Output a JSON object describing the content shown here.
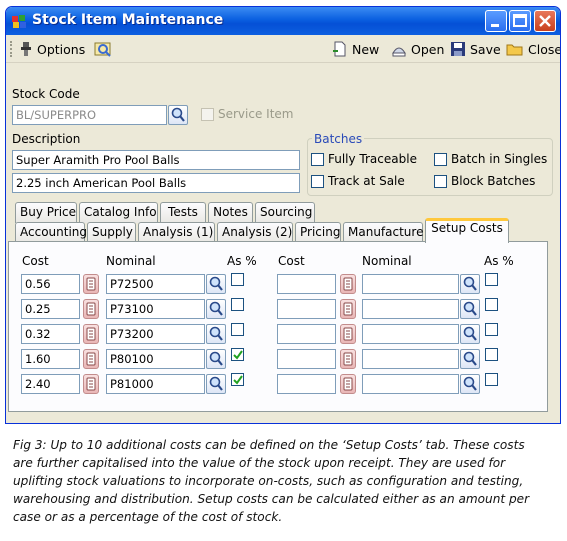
{
  "window": {
    "title": "Stock Item Maintenance",
    "buttons": {
      "minimize": "minimize",
      "maximize": "maximize",
      "close": "close"
    }
  },
  "toolbar": {
    "options_label": "Options",
    "new_label": "New",
    "open_label": "Open",
    "save_label": "Save",
    "close_label": "Close"
  },
  "form": {
    "stock_code_label": "Stock Code",
    "stock_code_value": "BL/SUPERPRO",
    "service_item_label": "Service Item",
    "description_label": "Description",
    "description_line1": "Super Aramith Pro Pool Balls",
    "description_line2": "2.25 inch American Pool Balls"
  },
  "batches": {
    "title": "Batches",
    "fully_traceable": "Fully Traceable",
    "batch_in_singles": "Batch in Singles",
    "track_at_sale": "Track at Sale",
    "block_batches": "Block Batches"
  },
  "tabs_row1": [
    "Buy Price",
    "Catalog Info",
    "Tests",
    "Notes",
    "Sourcing"
  ],
  "tabs_row2": [
    "Accounting",
    "Supply",
    "Analysis (1)",
    "Analysis (2)",
    "Pricing",
    "Manufacture",
    "Setup Costs"
  ],
  "active_tab": "Setup Costs",
  "setup_costs": {
    "cost_header": "Cost",
    "nominal_header": "Nominal",
    "as_pct_header": "As %",
    "left_rows": [
      {
        "cost": "0.56",
        "nominal": "P72500",
        "as_pct": false
      },
      {
        "cost": "0.25",
        "nominal": "P73100",
        "as_pct": false
      },
      {
        "cost": "0.32",
        "nominal": "P73200",
        "as_pct": false
      },
      {
        "cost": "1.60",
        "nominal": "P80100",
        "as_pct": true
      },
      {
        "cost": "2.40",
        "nominal": "P81000",
        "as_pct": true
      }
    ],
    "right_rows": [
      {
        "cost": "",
        "nominal": "",
        "as_pct": false
      },
      {
        "cost": "",
        "nominal": "",
        "as_pct": false
      },
      {
        "cost": "",
        "nominal": "",
        "as_pct": false
      },
      {
        "cost": "",
        "nominal": "",
        "as_pct": false
      },
      {
        "cost": "",
        "nominal": "",
        "as_pct": false
      }
    ]
  },
  "caption": {
    "line1": "Fig 3: Up to 10 additional costs can be defined on the ‘Setup Costs’ tab.  These costs",
    "line2": "are further capitalised into the value of the stock upon receipt.  They are used for",
    "line3": "uplifting stock valuations to incorporate on-costs, such as configuration and testing,",
    "line4": "warehousing and distribution.  Setup costs can be calculated either as an amount per",
    "line5": "case or as a percentage of the cost of stock."
  },
  "colors": {
    "titlebar": "#0a5fe0",
    "window_bg": "#ece9d8",
    "active_tab_accent": "#ffc83c",
    "check_green": "#21a121"
  },
  "icons": {
    "title": "app-icon",
    "options": "options-icon",
    "view": "binoculars-icon",
    "new": "new-doc-icon",
    "open": "open-icon",
    "save": "floppy-icon",
    "close": "folder-close-icon",
    "lookup": "magnifier-icon",
    "spin": "calculator-icon"
  }
}
